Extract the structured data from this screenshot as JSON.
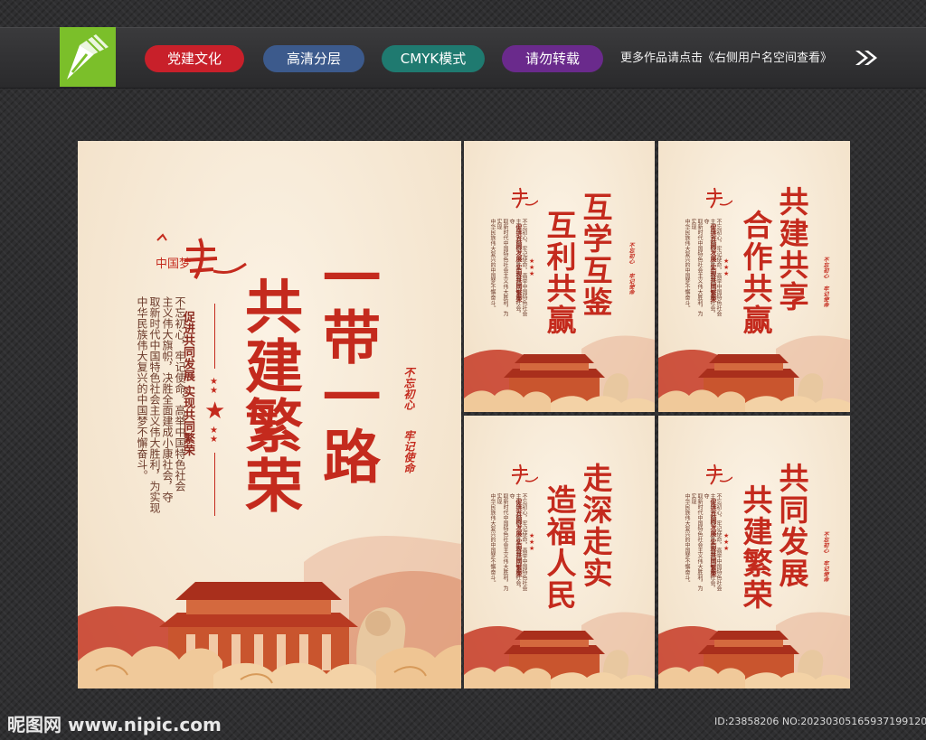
{
  "topbar": {
    "tags": [
      {
        "label": "党建文化",
        "color": "#c8202a"
      },
      {
        "label": "高清分层",
        "color": "#3c5a8c"
      },
      {
        "label": "CMYK模式",
        "color": "#1f7a70"
      },
      {
        "label": "请勿转载",
        "color": "#6a2a8c"
      }
    ],
    "notice": "更多作品请点击《右侧用户名空间查看》"
  },
  "main_poster": {
    "title_col1": "一带一路",
    "title_col2": "共建繁荣",
    "subtitle": "促进共同发展 实现共同繁荣",
    "body_lines": [
      "不忘初心，牢记使命，高举中国特色社会",
      "主义伟大旗帜，决胜全面建成小康社会，夺",
      "取新时代中国特色社会主义伟大胜利，为实现",
      "中华民族伟大复兴的中国梦不懈奋斗。"
    ],
    "badge1": "不忘初心",
    "badge2": "牢记使命"
  },
  "small_posters": [
    {
      "col1": "互学互鉴",
      "col2": "互利共赢"
    },
    {
      "col1": "共建共享",
      "col2": "合作共赢"
    },
    {
      "col1": "走深走实",
      "col2": "造福人民"
    },
    {
      "col1": "共同发展",
      "col2": "共建繁荣"
    }
  ],
  "footer": {
    "brand": "昵图网 www.nipic.com",
    "image_id": "ID:23858206 NO:20230305165937199120"
  },
  "colors": {
    "accent_red": "#c42a1d",
    "poster_bg": "#f6e9d6",
    "brand_green": "#7bbf2a"
  }
}
